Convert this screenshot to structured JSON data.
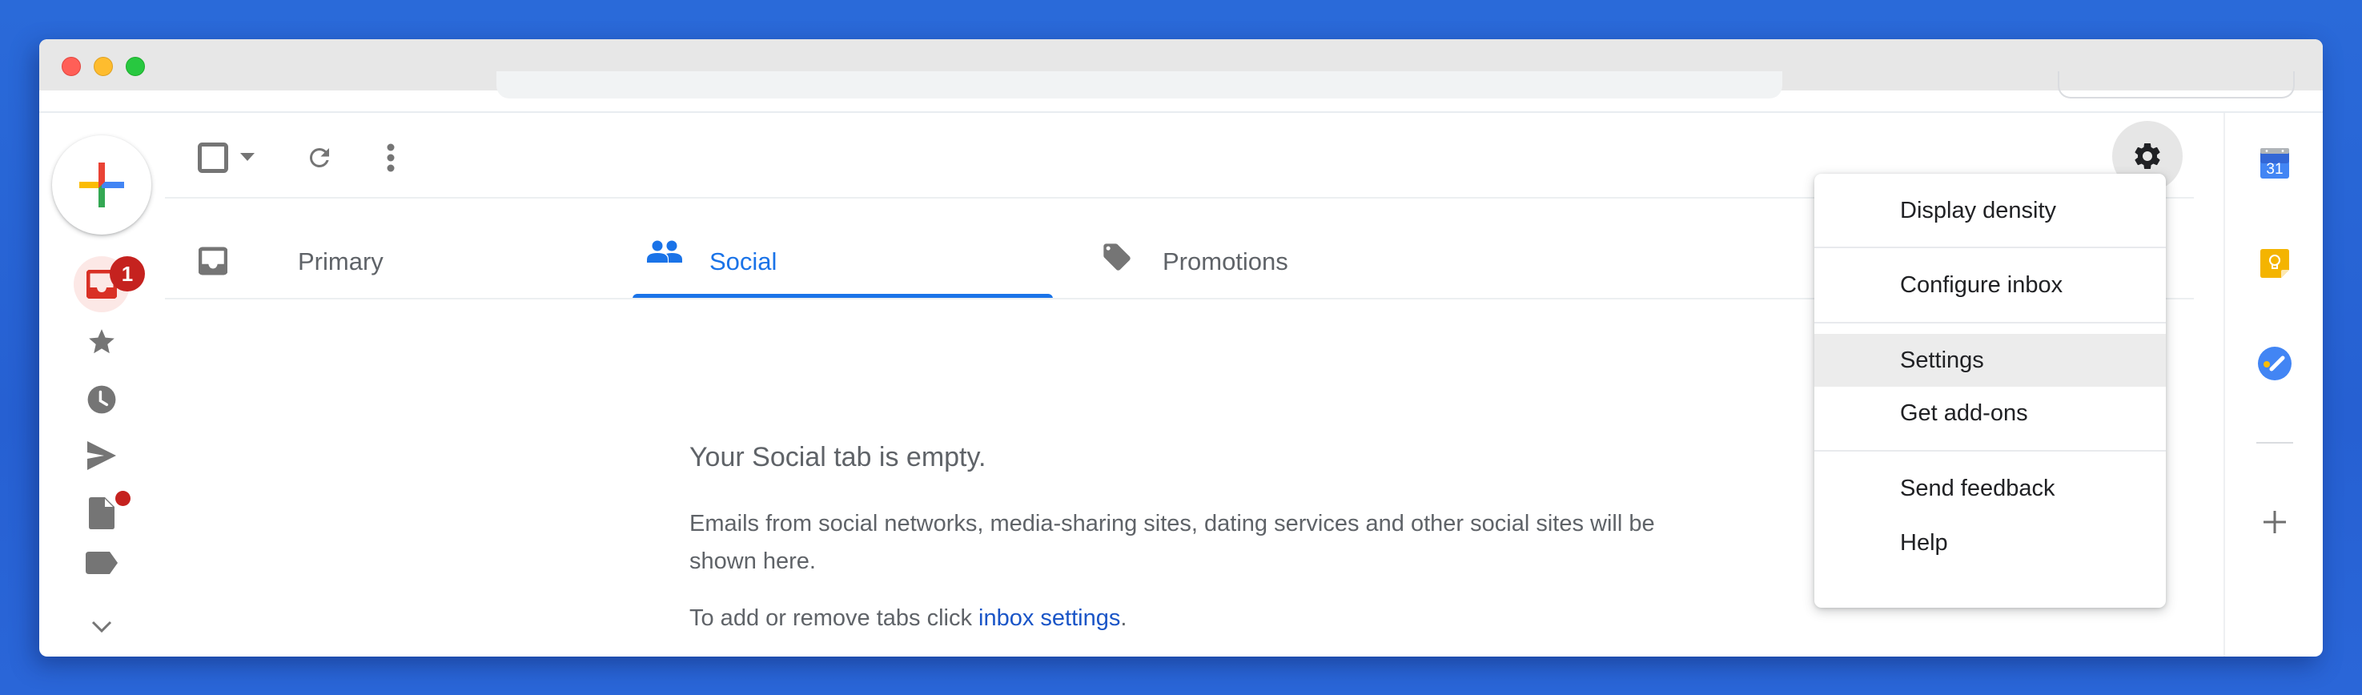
{
  "window": {
    "traffic_lights": [
      "close",
      "minimize",
      "maximize"
    ]
  },
  "sidebar": {
    "compose_icon": "plus-multicolor-icon",
    "items": [
      {
        "name": "inbox",
        "icon": "inbox-icon",
        "badge": "1",
        "active": true
      },
      {
        "name": "starred",
        "icon": "star-icon"
      },
      {
        "name": "snoozed",
        "icon": "clock-icon"
      },
      {
        "name": "sent",
        "icon": "send-icon"
      },
      {
        "name": "drafts",
        "icon": "draft-icon",
        "dot": true
      },
      {
        "name": "labels",
        "icon": "label-icon"
      },
      {
        "name": "more",
        "icon": "chevron-down-icon"
      }
    ]
  },
  "toolbar": {
    "select_icon": "checkbox-icon",
    "select_dropdown_icon": "caret-down-icon",
    "refresh_icon": "refresh-icon",
    "more_icon": "more-vert-icon"
  },
  "tabs": [
    {
      "label": "Primary",
      "icon": "inbox-icon",
      "active": false
    },
    {
      "label": "Social",
      "icon": "people-icon",
      "active": true
    },
    {
      "label": "Promotions",
      "icon": "tag-icon",
      "active": false
    }
  ],
  "empty_state": {
    "title": "Your Social tab is empty.",
    "body": "Emails from social networks, media-sharing sites, dating services and other social sites will be shown here.",
    "hint_prefix": "To add or remove tabs click ",
    "hint_link": "inbox settings",
    "hint_suffix": "."
  },
  "settings_menu": {
    "trigger_icon": "gear-icon",
    "items": [
      {
        "label": "Display density"
      },
      {
        "label": "Configure inbox"
      },
      {
        "label": "Settings",
        "highlighted": true
      },
      {
        "label": "Get add-ons"
      },
      {
        "label": "Send feedback"
      },
      {
        "label": "Help"
      }
    ]
  },
  "side_panel": {
    "calendar_day": "31",
    "items": [
      "calendar-icon",
      "keep-icon",
      "tasks-icon"
    ],
    "add_icon": "plus-icon"
  },
  "colors": {
    "accent": "#1a73e8",
    "badge": "#c5221f",
    "link": "#1a55c7",
    "text_secondary": "#5f6368",
    "menu_highlight": "#ececec",
    "desktop_bg": "#2a6ad9"
  }
}
